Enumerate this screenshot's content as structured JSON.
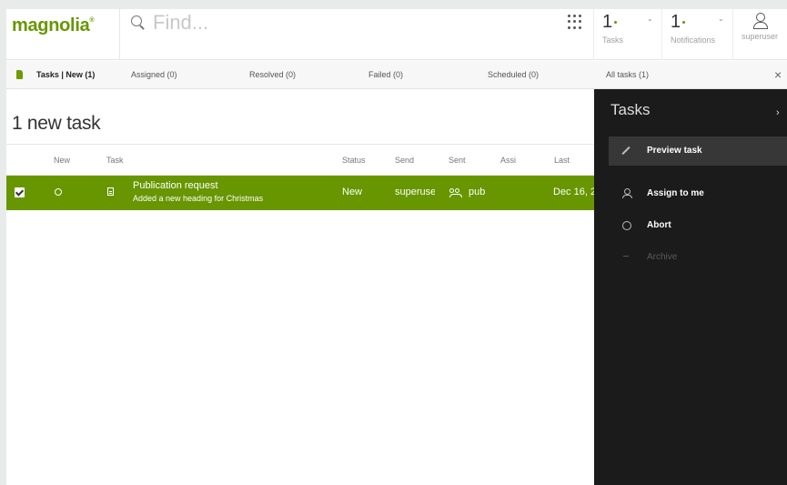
{
  "app": {
    "logo": "magnolia",
    "logo_mark": "®"
  },
  "search": {
    "placeholder": "Find..."
  },
  "header": {
    "tasks": {
      "count": "1",
      "label": "Tasks"
    },
    "notifications": {
      "count": "1",
      "label": "Notifications"
    },
    "user": {
      "label": "superuser"
    }
  },
  "tabs": [
    {
      "label": "Tasks | New (1)"
    },
    {
      "label": "Assigned (0)"
    },
    {
      "label": "Resolved (0)"
    },
    {
      "label": "Failed (0)"
    },
    {
      "label": "Scheduled (0)"
    },
    {
      "label": "All tasks (1)"
    }
  ],
  "close_label": "×",
  "main": {
    "title": "1 new task",
    "columns": [
      "New",
      "Task",
      "Status",
      "Send",
      "Sent",
      "Assi",
      "Last"
    ]
  },
  "row": {
    "title": "Publication request",
    "subtitle": "Added a new heading for Christmas",
    "status": "New",
    "sender": "superuser",
    "assignee": "pub",
    "last": "Dec 16, 2"
  },
  "actions_panel": {
    "title": "Tasks",
    "chevron": "›",
    "items": [
      {
        "label": "Preview task"
      },
      {
        "label": "Assign to me"
      },
      {
        "label": "Abort"
      },
      {
        "label": "Archive"
      }
    ]
  },
  "colors": {
    "brand": "#689600",
    "panel": "#1b1b1b"
  },
  "icons": [
    "search-icon",
    "apps-grid-icon",
    "user-icon",
    "pencil-icon",
    "person-icon",
    "abort-icon",
    "archive-icon",
    "group-icon",
    "document-icon"
  ]
}
